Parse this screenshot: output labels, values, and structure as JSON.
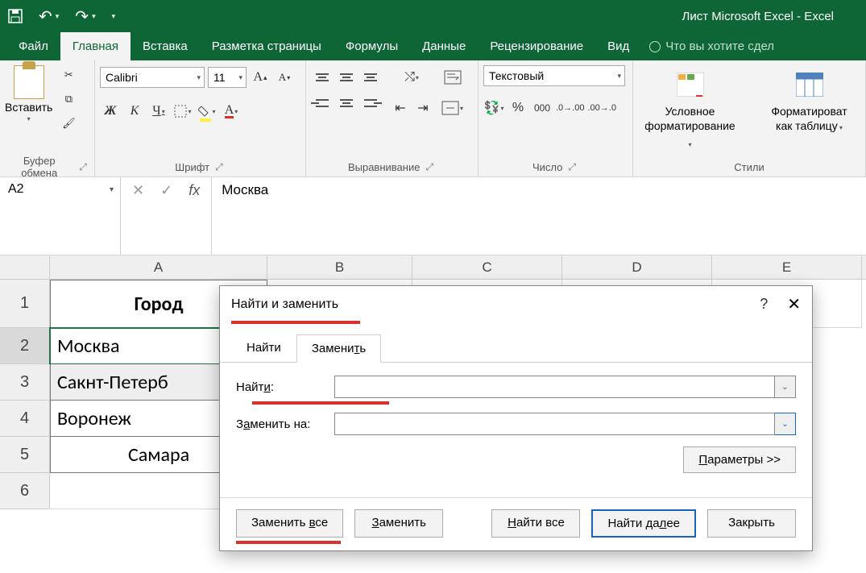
{
  "app": {
    "title": "Лист Microsoft Excel - Excel"
  },
  "qat": {
    "save": "💾",
    "undo": "↶",
    "redo": "↷"
  },
  "tabs": {
    "file": "Файл",
    "home": "Главная",
    "insert": "Вставка",
    "layout": "Разметка страницы",
    "formulas": "Формулы",
    "data": "Данные",
    "review": "Рецензирование",
    "view": "Вид",
    "tellme": "Что вы хотите сдел"
  },
  "ribbon": {
    "clipboard": {
      "label": "Буфер обмена",
      "paste": "Вставить"
    },
    "font": {
      "label": "Шрифт",
      "name": "Calibri",
      "size": "11",
      "bold": "Ж",
      "italic": "К",
      "underline": "Ч",
      "letterA": "А"
    },
    "align": {
      "label": "Выравнивание"
    },
    "number": {
      "label": "Число",
      "format": "Текстовый",
      "pct": "%",
      "comma": "000"
    },
    "styles": {
      "label": "Стили",
      "cond": "Условное форматирование",
      "table": "Форматироват как таблицу"
    }
  },
  "formula": {
    "namebox": "A2",
    "content": "Москва"
  },
  "columns": [
    "A",
    "B",
    "C",
    "D",
    "E"
  ],
  "rows": [
    {
      "n": "1",
      "a": "Город"
    },
    {
      "n": "2",
      "a": "Москва"
    },
    {
      "n": "3",
      "a": "Сакнт-Петерб"
    },
    {
      "n": "4",
      "a": "Воронеж"
    },
    {
      "n": "5",
      "a": "Самара"
    },
    {
      "n": "6",
      "a": ""
    }
  ],
  "dialog": {
    "title": "Найти и заменить",
    "tab_find": "Найти",
    "tab_replace": "Заменить",
    "find_label": "Найти:",
    "replace_label": "Заменить на:",
    "find_value": "",
    "replace_value": "",
    "params": "Параметры >>",
    "replace_all": "Заменить все",
    "replace": "Заменить",
    "find_all": "Найти все",
    "find_next": "Найти далее",
    "close": "Закрыть"
  }
}
